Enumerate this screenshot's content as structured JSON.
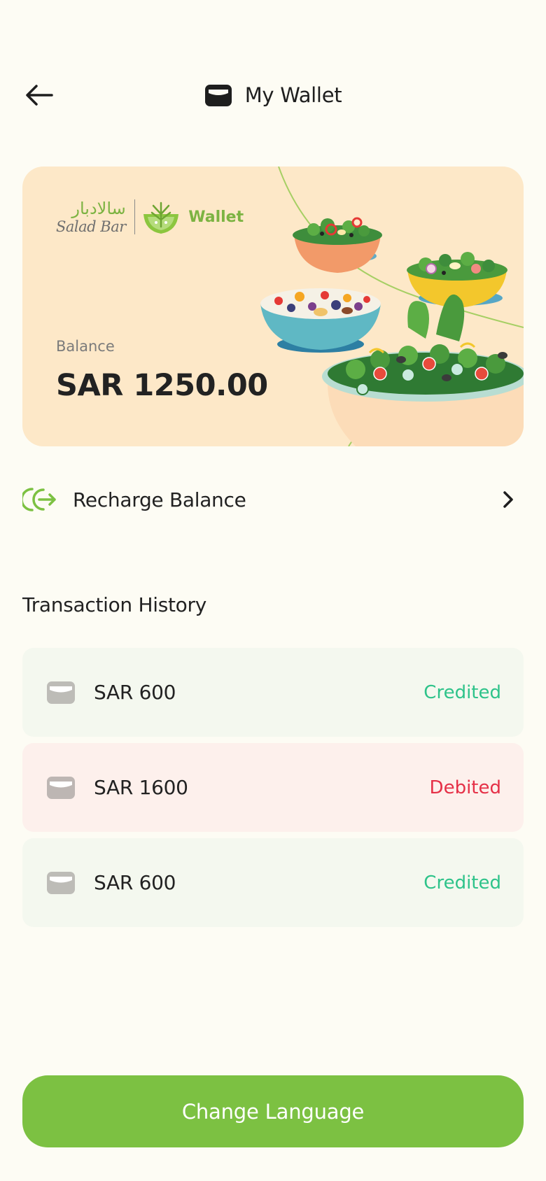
{
  "header": {
    "title": "My Wallet",
    "back_icon": "arrow-left-icon",
    "title_icon": "wallet-icon"
  },
  "wallet_card": {
    "brand_arabic": "سالادبار",
    "brand_latin": "Salad Bar",
    "brand_wallet": "Wallet",
    "balance_label": "Balance",
    "balance_amount": "SAR 1250.00",
    "background_color": "#fde8c8",
    "brand_color": "#7cb342"
  },
  "recharge": {
    "label": "Recharge Balance",
    "icon": "recharge-icon",
    "chevron_icon": "chevron-right-icon"
  },
  "history": {
    "title": "Transaction History",
    "items": [
      {
        "amount": "SAR 600",
        "status": "Credited",
        "type": "credited"
      },
      {
        "amount": "SAR 1600",
        "status": "Debited",
        "type": "debited"
      },
      {
        "amount": "SAR 600",
        "status": "Credited",
        "type": "credited"
      }
    ]
  },
  "footer": {
    "change_language_label": "Change Language"
  },
  "colors": {
    "accent": "#7cc142",
    "credited": "#2ec38a",
    "debited": "#e53047",
    "page_background": "#fdfcf4"
  }
}
